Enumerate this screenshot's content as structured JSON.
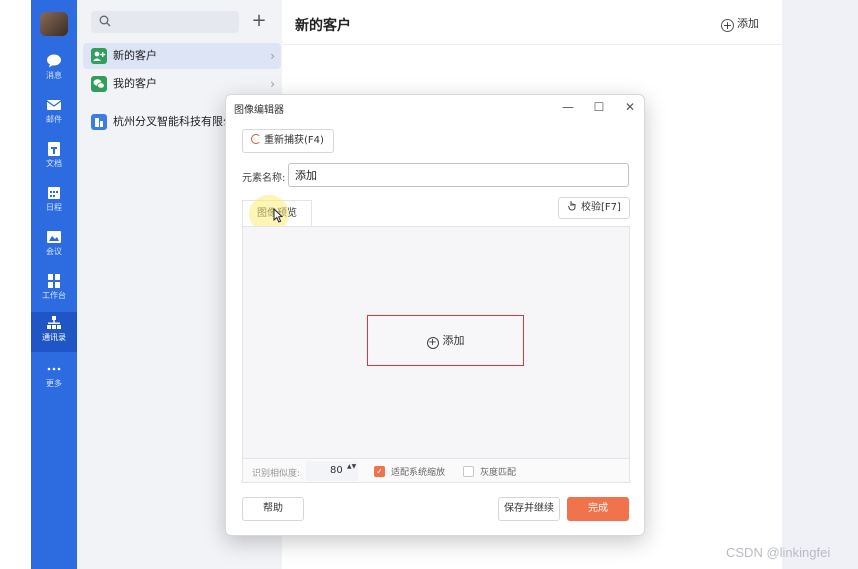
{
  "colors": {
    "rail": "#2d6be0",
    "accent": "#f0734b",
    "target_border": "#d9363e"
  },
  "rail": {
    "items": [
      {
        "label": "消息",
        "icon": "chat-bubble-icon"
      },
      {
        "label": "邮件",
        "icon": "mail-icon"
      },
      {
        "label": "文档",
        "icon": "document-icon"
      },
      {
        "label": "日程",
        "icon": "calendar-icon"
      },
      {
        "label": "会议",
        "icon": "meeting-icon"
      },
      {
        "label": "工作台",
        "icon": "workbench-grid-icon"
      },
      {
        "label": "通讯录",
        "icon": "org-chart-icon"
      },
      {
        "label": "更多",
        "icon": "more-dots-icon"
      }
    ]
  },
  "list": {
    "search_icon": "search-icon",
    "add_label": "+",
    "items": [
      {
        "label": "新的客户",
        "icon": "new-customer-icon",
        "color": "#2fa05b",
        "chevron": "›"
      },
      {
        "label": "我的客户",
        "icon": "wechat-icon",
        "color": "#2fa05b",
        "chevron": "›"
      },
      {
        "label": "杭州分叉智能科技有限公司",
        "icon": "company-icon",
        "color": "#3c7ce6"
      }
    ]
  },
  "main": {
    "title": "新的客户",
    "add_label": "添加",
    "add_icon": "+"
  },
  "dialog": {
    "title": "图像编辑器",
    "controls": {
      "minimize": "—",
      "maximize": "☐",
      "close": "✕"
    },
    "recapture_label": "重新捕获(F4)",
    "element_name_label": "元素名称:",
    "element_name_value": "添加",
    "preview_tab_label": "图像预览",
    "verify_label": "校验[F7]",
    "verify_icon": "hand-pointer-icon",
    "preview_target_label": "添加",
    "preview_target_icon": "+",
    "similarity_label": "识别相似度:",
    "similarity_value": "80",
    "stepper_arrows": "▲▼",
    "adapt_scaling_label": "适配系统缩放",
    "adapt_scaling_checked": true,
    "grayscale_label": "灰度匹配",
    "grayscale_checked": false,
    "check_mark": "✓",
    "help_label": "帮助",
    "save_continue_label": "保存并继续",
    "done_label": "完成"
  },
  "watermark": "CSDN @linkingfei"
}
